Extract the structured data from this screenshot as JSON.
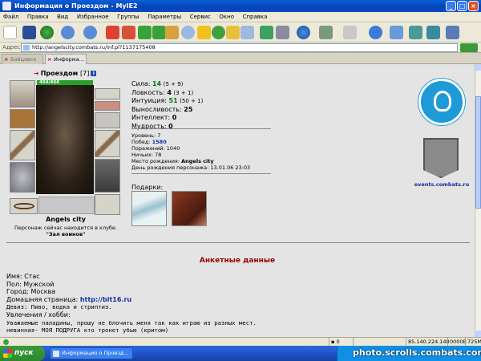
{
  "window": {
    "title": "Информация о Проездом - MyIE2"
  },
  "menu": [
    "Файл",
    "Правка",
    "Вид",
    "Избранное",
    "Группы",
    "Параметры",
    "Сервис",
    "Окно",
    "Справка"
  ],
  "address": {
    "label": "Адрес",
    "url": "http://angelscity.combats.ru/inf.pl?1137175408"
  },
  "tabs": [
    {
      "label": "Бойцовск"
    },
    {
      "label": "Информа..."
    }
  ],
  "character": {
    "name": "Проездом",
    "level": "[7]",
    "info_glyph": "i",
    "hp": "464/464",
    "city": "Angels city",
    "location_text": "Персонаж сейчас находится в клубе.",
    "location_place": "\"Зал воинов\""
  },
  "stats": [
    {
      "label": "Сила:",
      "value": "14",
      "extra": "(5 + 9)"
    },
    {
      "label": "Ловкость:",
      "value": "4",
      "extra": "(3 + 1)"
    },
    {
      "label": "Интуиция:",
      "value": "51",
      "extra": "(50 + 1)"
    },
    {
      "label": "Выносливость:",
      "value": "25",
      "extra": ""
    },
    {
      "label": "Интеллект:",
      "value": "0",
      "extra": ""
    },
    {
      "label": "Мудрость:",
      "value": "0",
      "extra": ""
    }
  ],
  "info": {
    "level": {
      "label": "Уровень:",
      "value": "7"
    },
    "wins": {
      "label": "Побед:",
      "value": "1580"
    },
    "losses": {
      "label": "Поражений:",
      "value": "1040"
    },
    "draws": {
      "label": "Ничьих:",
      "value": "78"
    },
    "birthplace": {
      "label": "Место рождения:",
      "value": "Angels city"
    },
    "birthday": {
      "label": "День рождения персонажа:",
      "value": "13.01.06 23:03"
    }
  },
  "gifts": {
    "label": "Подарки:"
  },
  "emblem": {
    "site": "events.combats.ru"
  },
  "profile": {
    "title": "Анкетные данные",
    "name": "Имя: Стас",
    "gender": "Пол: Мужской",
    "city": "Город: Москва",
    "homepage_label": "Домашняя страница:",
    "homepage_url": "http://bit16.ru",
    "motto": "Девиз: Пиво, водка и стриптиз.",
    "hobbies_label": "Увлечения / хобби:",
    "hobbies_line1": "Уважаемые паладины, прошу не блочить меня так как играю из разных мест.",
    "hobbies_line2": "невинная- МОЯ ПОДРУГА кто тронет убью (критом)"
  },
  "statusbar": {
    "count": "0",
    "ip": "85.140.224.148",
    "traffic": "0000B",
    "memory": "725M"
  },
  "taskbar": {
    "start": "пуск",
    "task": "Информация о Проезд..."
  },
  "watermark": "photo.scrolls.combats.com",
  "colors": {
    "stat_value": "#0b7a0b",
    "section_title": "#990000",
    "link": "#1030a0",
    "hp": "#28a028"
  }
}
